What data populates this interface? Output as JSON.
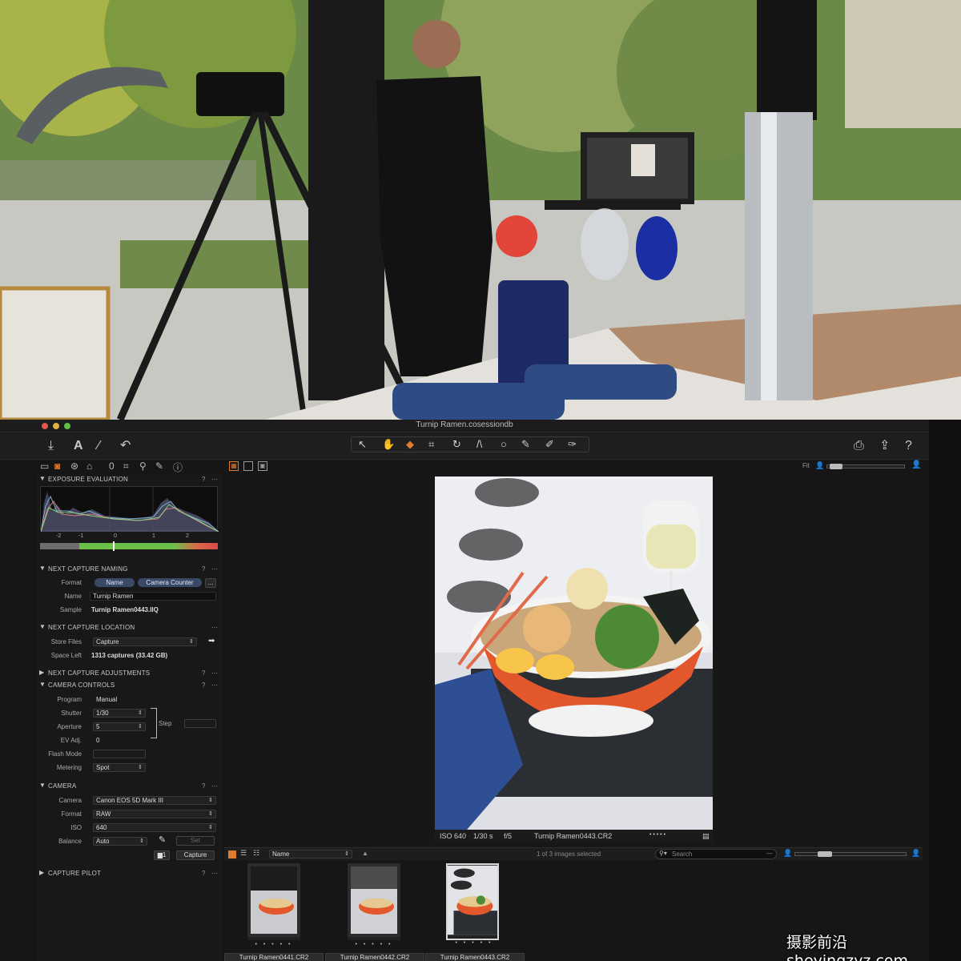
{
  "window": {
    "title": "Turnip Ramen.cosessiondb"
  },
  "toolbar": {
    "left_icons": [
      "import-icon",
      "text-icon",
      "brush-icon",
      "undo-icon"
    ],
    "tools": [
      "cursor-icon",
      "pan-icon",
      "picker-icon",
      "crop-icon",
      "rotate-icon",
      "keystone-icon",
      "circle-icon",
      "pen-icon",
      "brush-icon",
      "eraser-icon"
    ],
    "right_icons": [
      "print-icon",
      "export-icon",
      "help-icon"
    ]
  },
  "tool_tabs": [
    "library-icon",
    "capture-icon",
    "color-icon",
    "exposure-icon",
    "lens-icon",
    "crop-icon",
    "details-icon",
    "adjust-icon",
    "metadata-icon"
  ],
  "exposure_evaluation": {
    "title": "EXPOSURE EVALUATION",
    "ticks": [
      "-2",
      "-1",
      "0",
      "1",
      "2"
    ]
  },
  "next_capture_naming": {
    "title": "NEXT CAPTURE NAMING",
    "format_label": "Format",
    "format_tokens": [
      "Name",
      "Camera Counter"
    ],
    "name_label": "Name",
    "name_value": "Turnip Ramen",
    "sample_label": "Sample",
    "sample_value": "Turnip Ramen0443.IIQ"
  },
  "next_capture_location": {
    "title": "NEXT CAPTURE LOCATION",
    "store_label": "Store Files",
    "store_value": "Capture",
    "space_label": "Space Left",
    "space_value": "1313 captures (33.42 GB)"
  },
  "next_capture_adjustments": {
    "title": "NEXT CAPTURE ADJUSTMENTS"
  },
  "camera_controls": {
    "title": "CAMERA CONTROLS",
    "program_label": "Program",
    "program_value": "Manual",
    "shutter_label": "Shutter",
    "shutter_value": "1/30",
    "aperture_label": "Aperture",
    "aperture_value": "5",
    "ev_label": "EV Adj.",
    "ev_value": "0",
    "step_label": "Step",
    "flash_label": "Flash Mode",
    "metering_label": "Metering",
    "metering_value": "Spot"
  },
  "camera": {
    "title": "CAMERA",
    "camera_label": "Camera",
    "camera_value": "Canon EOS 5D Mark III",
    "format_label": "Format",
    "format_value": "RAW",
    "iso_label": "ISO",
    "iso_value": "640",
    "balance_label": "Balance",
    "balance_value": "Auto",
    "set_label": "Set",
    "capture_button": "Capture"
  },
  "capture_pilot": {
    "title": "CAPTURE PILOT"
  },
  "viewer": {
    "fit_label": "Fit",
    "info": {
      "iso": "ISO 640",
      "shutter": "1/30 s",
      "aperture": "f/5",
      "filename": "Turnip Ramen0443.CR2"
    }
  },
  "browser": {
    "sort_value": "Name",
    "selected_text": "1 of 3 images selected",
    "search_placeholder": "Search",
    "thumbnails": [
      {
        "name": "Turnip Ramen0441.CR2",
        "selected": false
      },
      {
        "name": "Turnip Ramen0442.CR2",
        "selected": false
      },
      {
        "name": "Turnip Ramen0443.CR2",
        "selected": true
      }
    ],
    "stars": "• • • • •"
  },
  "watermark": "摄影前沿 sheyingzyz.com",
  "colors": {
    "accent": "#e07a2c",
    "panel": "#181818",
    "token": "#3a4a66"
  }
}
